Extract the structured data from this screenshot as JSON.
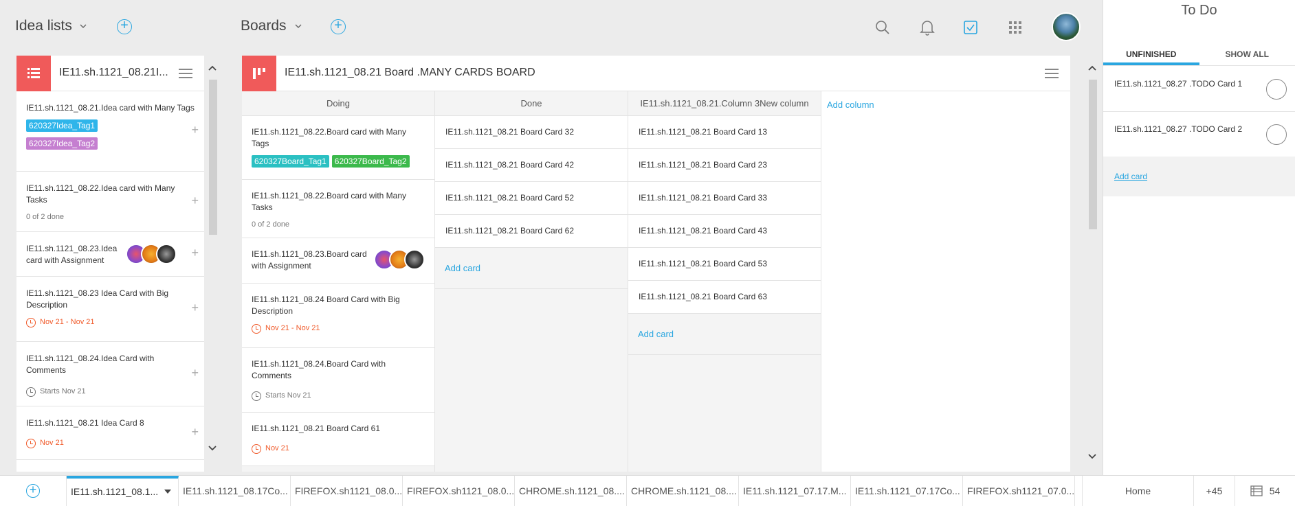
{
  "header": {
    "idea_lists_label": "Idea lists",
    "boards_label": "Boards"
  },
  "idea_panel": {
    "title": "IE11.sh.1121_08.21I...",
    "cards": [
      {
        "text": "IE11.sh.1121_08.21.Idea card with Many Tags",
        "tags": [
          "620327Idea_Tag1",
          "620327Idea_Tag2"
        ]
      },
      {
        "text": "IE11.sh.1121_08.22.Idea card with Many Tasks",
        "meta": "0 of 2 done"
      },
      {
        "text": "IE11.sh.1121_08.23.Idea card with Assignment"
      },
      {
        "text": "IE11.sh.1121_08.23 Idea Card with Big Description",
        "date": "Nov 21 - Nov 21"
      },
      {
        "text": "IE11.sh.1121_08.24.Idea Card with Comments",
        "date": "Starts Nov 21"
      },
      {
        "text": "IE11.sh.1121_08.21 Idea Card 8",
        "date": "Nov 21"
      }
    ]
  },
  "board_panel": {
    "title": "IE11.sh.1121_08.21 Board .MANY CARDS BOARD",
    "add_column_label": "Add column",
    "columns": [
      {
        "name": "Doing",
        "cards": [
          {
            "text": "IE11.sh.1121_08.22.Board card with Many Tags",
            "tags": [
              "620327Board_Tag1",
              "620327Board_Tag2"
            ]
          },
          {
            "text": "IE11.sh.1121_08.22.Board card with Many Tasks",
            "meta": "0 of 2 done"
          },
          {
            "text": "IE11.sh.1121_08.23.Board card with Assignment"
          },
          {
            "text": "IE11.sh.1121_08.24 Board Card with Big Description",
            "date": "Nov 21 - Nov 21"
          },
          {
            "text": "IE11.sh.1121_08.24.Board Card with Comments",
            "date": "Starts Nov 21"
          },
          {
            "text": "IE11.sh.1121_08.21 Board Card 61",
            "date": "Nov 21"
          }
        ]
      },
      {
        "name": "Done",
        "cards": [
          "IE11.sh.1121_08.21 Board Card 32",
          "IE11.sh.1121_08.21 Board Card 42",
          "IE11.sh.1121_08.21 Board Card 52",
          "IE11.sh.1121_08.21 Board Card 62"
        ],
        "add_label": "Add card"
      },
      {
        "name": "IE11.sh.1121_08.21.Column 3New column",
        "cards": [
          "IE11.sh.1121_08.21 Board Card 13",
          "IE11.sh.1121_08.21 Board Card 23",
          "IE11.sh.1121_08.21 Board Card 33",
          "IE11.sh.1121_08.21 Board Card 43",
          "IE11.sh.1121_08.21 Board Card 53",
          "IE11.sh.1121_08.21 Board Card 63"
        ],
        "add_label": "Add card"
      }
    ]
  },
  "todo_panel": {
    "title": "To Do",
    "tab_unfinished": "UNFINISHED",
    "tab_show_all": "SHOW ALL",
    "items": [
      "IE11.sh.1121_08.27 .TODO Card 1",
      "IE11.sh.1121_08.27 .TODO Card 2"
    ],
    "add_label": "Add card"
  },
  "bottom_tabs": {
    "tabs": [
      "IE11.sh.1121_08.1...",
      "IE11.sh.1121_08.17Co...",
      "FIREFOX.sh1121_08.0...",
      "FIREFOX.sh1121_08.0...",
      "CHROME.sh.1121_08....",
      "CHROME.sh.1121_08....",
      "IE11.sh.1121_07.17.M...",
      "IE11.sh.1121_07.17Co...",
      "FIREFOX.sh1121_07.0..."
    ],
    "home": "Home",
    "more": "+45",
    "count": "54"
  },
  "colors": {
    "accent": "#2aa6e0",
    "idea_header": "#f05a5a",
    "tag_blue": "#2fb5ea",
    "tag_purple": "#c57fd0",
    "tag_teal": "#2bc0c2",
    "tag_green": "#3cb94c",
    "date_orange": "#f05a2a"
  }
}
